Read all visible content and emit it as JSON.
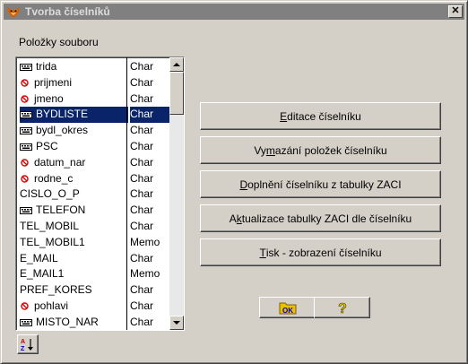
{
  "window": {
    "title": "Tvorba číselníků",
    "close_label": "✕"
  },
  "list_label": "Položky souboru",
  "fields": [
    {
      "name": "trida",
      "type": "Char",
      "icon": "keyboard-icon"
    },
    {
      "name": "prijmeni",
      "type": "Char",
      "icon": "no-entry-icon"
    },
    {
      "name": "jmeno",
      "type": "Char",
      "icon": "no-entry-icon"
    },
    {
      "name": "BYDLISTE",
      "type": "Char",
      "icon": "keyboard-icon",
      "selected": true
    },
    {
      "name": "bydl_okres",
      "type": "Char",
      "icon": "keyboard-icon"
    },
    {
      "name": "PSC",
      "type": "Char",
      "icon": "keyboard-icon"
    },
    {
      "name": "datum_nar",
      "type": "Char",
      "icon": "no-entry-icon"
    },
    {
      "name": "rodne_c",
      "type": "Char",
      "icon": "no-entry-icon"
    },
    {
      "name": "CISLO_O_P",
      "type": "Char",
      "icon": ""
    },
    {
      "name": "TELEFON",
      "type": "Char",
      "icon": "keyboard-icon"
    },
    {
      "name": "TEL_MOBIL",
      "type": "Char",
      "icon": ""
    },
    {
      "name": "TEL_MOBIL1",
      "type": "Memo",
      "icon": ""
    },
    {
      "name": "E_MAIL",
      "type": "Char",
      "icon": ""
    },
    {
      "name": "E_MAIL1",
      "type": "Memo",
      "icon": ""
    },
    {
      "name": "PREF_KORES",
      "type": "Char",
      "icon": ""
    },
    {
      "name": "pohlavi",
      "type": "Char",
      "icon": "no-entry-icon"
    },
    {
      "name": "MISTO_NAR",
      "type": "Char",
      "icon": "keyboard-icon"
    }
  ],
  "buttons": [
    {
      "pre": "",
      "accel": "E",
      "post": "ditace číselníku"
    },
    {
      "pre": "Vy",
      "accel": "m",
      "post": "azání položek číselníku"
    },
    {
      "pre": "",
      "accel": "D",
      "post": "oplnění číselníku z tabulky ZACI"
    },
    {
      "pre": "A",
      "accel": "k",
      "post": "tualizace tabulky ZACI dle číselníku"
    },
    {
      "pre": "",
      "accel": "T",
      "post": "isk - zobrazení číselníku"
    }
  ],
  "toolbar": {
    "sort_icon": "sort-az-icon",
    "ok_icon": "ok-folder-icon",
    "help_icon": "question-icon"
  },
  "colors": {
    "selection": "#0a246a",
    "no_entry": "#e00000",
    "ok_blue": "#0000c0",
    "folder_yellow": "#e8c000"
  }
}
